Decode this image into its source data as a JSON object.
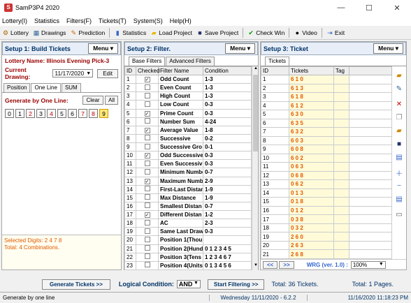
{
  "app": {
    "title": "SamP3P4 2020"
  },
  "menu": [
    "Lottery(I)",
    "Statistics",
    "Filters(F)",
    "Tickets(T)",
    "System(S)",
    "Help(H)"
  ],
  "toolbar": {
    "lottery": "Lottery",
    "drawings": "Drawings",
    "prediction": "Prediction",
    "statistics": "Statistics",
    "load_project": "Load Project",
    "save_project": "Save Project",
    "check_win": "Check Win",
    "video": "Video",
    "exit": "Exit"
  },
  "step1": {
    "title": "Setup 1: Build Tickets",
    "menu_label": "Menu",
    "lottery_label": "Lottery Name:",
    "lottery_name": "Illinois Evening Pick-3",
    "drawing_label": "Current Drawing:",
    "drawing_date": "11/17/2020",
    "edit": "Edit",
    "tabs": [
      "Position",
      "One Line",
      "SUM"
    ],
    "generate_label": "Generate by One Line:",
    "clear": "Clear",
    "all": "All",
    "digits": [
      "0",
      "1",
      "2",
      "3",
      "4",
      "5",
      "6",
      "7",
      "8",
      "9"
    ],
    "selected_line": "Selected Digits: 2 4 7 8",
    "total_line": "Total: 4 Combinations."
  },
  "step2": {
    "title": "Setup 2: Filter.",
    "menu_label": "Menu",
    "tabs": [
      "Base Filters",
      "Advanced Filters"
    ],
    "columns": [
      "ID",
      "Checked",
      "Filter Name",
      "Condition"
    ],
    "rows": [
      {
        "id": "1",
        "checked": true,
        "name": "Odd Count",
        "cond": "1-3"
      },
      {
        "id": "2",
        "checked": false,
        "name": "Even Count",
        "cond": "1-3"
      },
      {
        "id": "3",
        "checked": false,
        "name": "High Count",
        "cond": "1-3"
      },
      {
        "id": "4",
        "checked": false,
        "name": "Low Count",
        "cond": "0-3"
      },
      {
        "id": "5",
        "checked": true,
        "name": "Prime Count",
        "cond": "0-3"
      },
      {
        "id": "6",
        "checked": false,
        "name": "Number Sum",
        "cond": "4-24"
      },
      {
        "id": "7",
        "checked": true,
        "name": "Average Value",
        "cond": "1-8"
      },
      {
        "id": "8",
        "checked": false,
        "name": "Successive",
        "cond": "0-2"
      },
      {
        "id": "9",
        "checked": false,
        "name": "Successive Gro",
        "cond": "0-1"
      },
      {
        "id": "10",
        "checked": true,
        "name": "Odd Successive",
        "cond": "0-3"
      },
      {
        "id": "11",
        "checked": false,
        "name": "Even Successiv",
        "cond": "0-3"
      },
      {
        "id": "12",
        "checked": false,
        "name": "Minimum Numbe",
        "cond": "0-7"
      },
      {
        "id": "13",
        "checked": true,
        "name": "Maximum Numbe",
        "cond": "2-9"
      },
      {
        "id": "14",
        "checked": false,
        "name": "First-Last Distan",
        "cond": "1-9"
      },
      {
        "id": "15",
        "checked": false,
        "name": "Max Distance",
        "cond": "1-9"
      },
      {
        "id": "16",
        "checked": false,
        "name": "Smallest Distan",
        "cond": "0-7"
      },
      {
        "id": "17",
        "checked": true,
        "name": "Different Distan",
        "cond": "1-2"
      },
      {
        "id": "18",
        "checked": false,
        "name": "AC",
        "cond": "2-3"
      },
      {
        "id": "19",
        "checked": false,
        "name": "Same Last Draw",
        "cond": "0-3"
      },
      {
        "id": "20",
        "checked": false,
        "name": "Position 1(Thou",
        "cond": ""
      },
      {
        "id": "21",
        "checked": false,
        "name": "Position 2(Hund",
        "cond": "0 1 2 3 4 5"
      },
      {
        "id": "22",
        "checked": false,
        "name": "Position 3(Tens",
        "cond": "1 2 3 4 6 7"
      },
      {
        "id": "23",
        "checked": false,
        "name": "Position 4(Units",
        "cond": "0 1 3 4 5 6"
      }
    ]
  },
  "step3": {
    "title": "Setup 3: Ticket",
    "menu_label": "Menu",
    "tabs": [
      "Tickets"
    ],
    "columns": [
      "ID",
      "Tickets",
      "Tag"
    ],
    "rows": [
      {
        "id": "1",
        "ticket": "6 1 0"
      },
      {
        "id": "2",
        "ticket": "6 1 3"
      },
      {
        "id": "3",
        "ticket": "6 1 8"
      },
      {
        "id": "4",
        "ticket": "6 1 2"
      },
      {
        "id": "5",
        "ticket": "6 3 0"
      },
      {
        "id": "6",
        "ticket": "6 3 5"
      },
      {
        "id": "7",
        "ticket": "6 3 2"
      },
      {
        "id": "8",
        "ticket": "6 0 3"
      },
      {
        "id": "9",
        "ticket": "6 0 8"
      },
      {
        "id": "10",
        "ticket": "6 0 2"
      },
      {
        "id": "11",
        "ticket": "0 6 3"
      },
      {
        "id": "12",
        "ticket": "0 6 8"
      },
      {
        "id": "13",
        "ticket": "0 6 2"
      },
      {
        "id": "14",
        "ticket": "0 1 3"
      },
      {
        "id": "15",
        "ticket": "0 1 8"
      },
      {
        "id": "16",
        "ticket": "0 1 2"
      },
      {
        "id": "17",
        "ticket": "0 3 8"
      },
      {
        "id": "18",
        "ticket": "0 3 2"
      },
      {
        "id": "19",
        "ticket": "2 6 0"
      },
      {
        "id": "20",
        "ticket": "2 6 3"
      },
      {
        "id": "21",
        "ticket": "2 6 8"
      }
    ],
    "wrg_label": "WRG (ver. 1.0) :",
    "zoom": "100%"
  },
  "bottom": {
    "generate": "Generate Tickets >>",
    "logical_label": "Logical Condition:",
    "logical_value": "AND",
    "start_filter": "Start Filtering >>",
    "total_tickets": "Total: 36 Tickets.",
    "total_pages": "Total: 1 Pages."
  },
  "status": {
    "left": "Generate by one line",
    "middle": "Wednesday 11/11/2020 - 6.2.2",
    "right": "11/16/2020 11:18:23 PM"
  }
}
